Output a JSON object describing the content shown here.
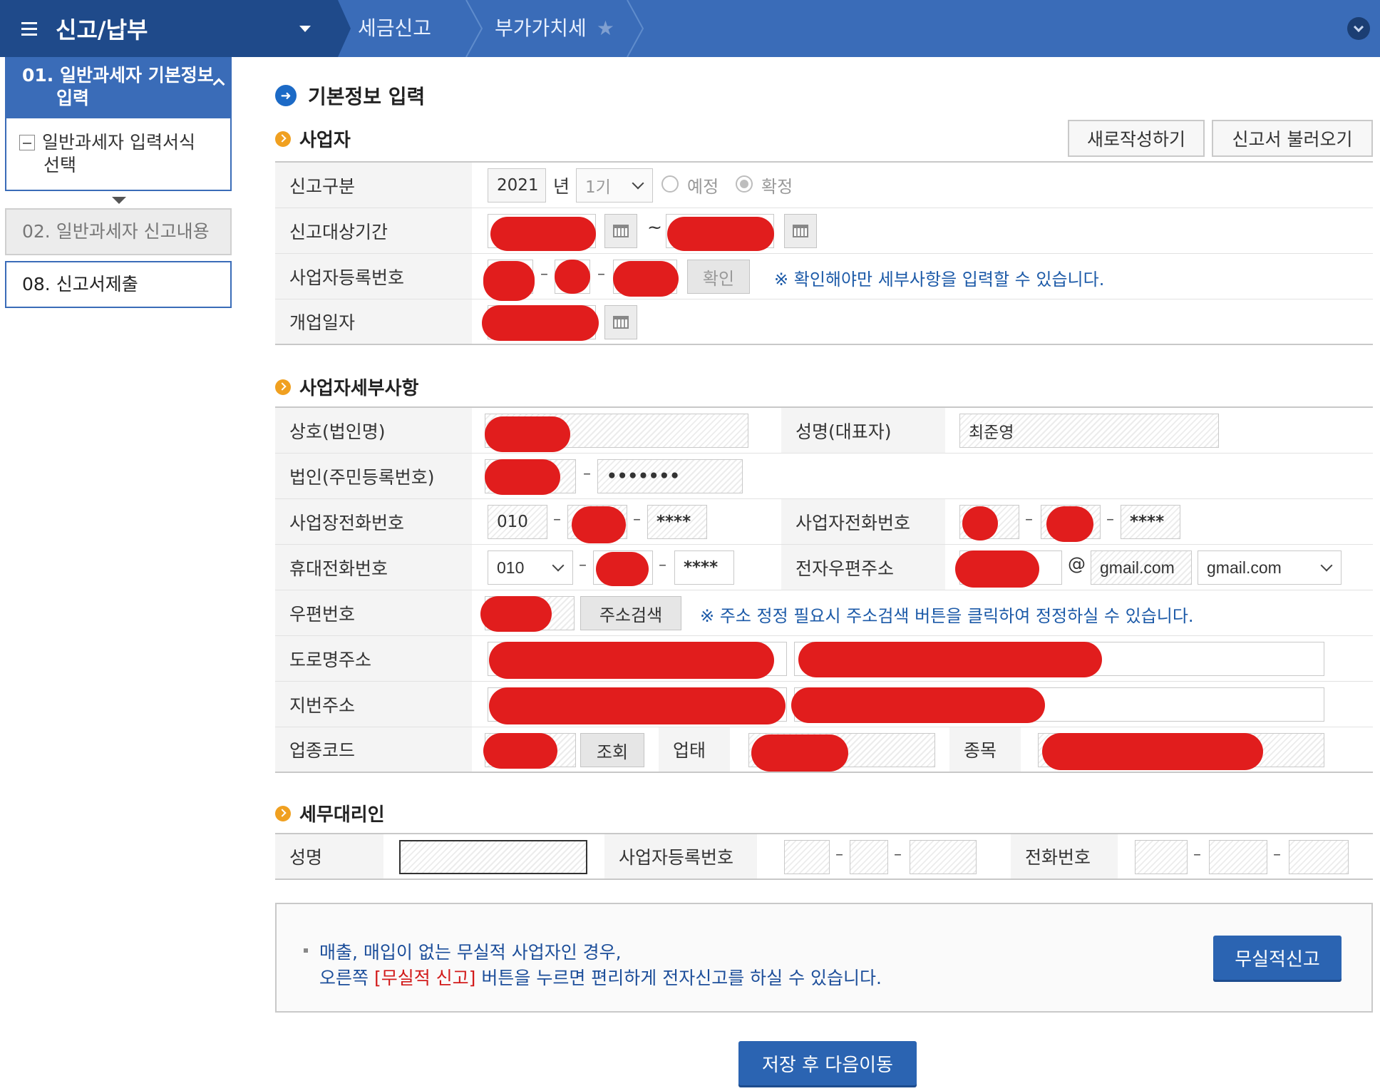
{
  "topbar": {
    "menu_title": "신고/납부",
    "crumbs": [
      "세금신고",
      "부가가치세"
    ]
  },
  "sidebar": {
    "step1_label": "01. 일반과세자 기본정보",
    "step1_label2": "입력",
    "step1_sub": "일반과세자 입력서식",
    "step1_sub2": "선택",
    "step2_label": "02. 일반과세자 신고내용",
    "step8_label": "08. 신고서제출"
  },
  "main": {
    "title": "기본정보 입력",
    "sections": {
      "business": "사업자",
      "detail": "사업자세부사항",
      "agent": "세무대리인"
    },
    "buttons": {
      "new_write": "새로작성하기",
      "load": "신고서 불러오기",
      "confirm": "확인",
      "address_search": "주소검색",
      "lookup": "조회",
      "zero_report": "무실적신고",
      "save_next": "저장 후 다음이동"
    },
    "business": {
      "report_type_label": "신고구분",
      "year": "2021",
      "year_unit": "년",
      "period": "1기",
      "radio_prelim": "예정",
      "radio_final": "확정",
      "target_period_label": "신고대상기간",
      "tilde": "~",
      "reg_no_label": "사업자등록번호",
      "reg_no_note": "※ 확인해야만 세부사항을 입력할 수 있습니다.",
      "open_date_label": "개업일자"
    },
    "detail": {
      "company_label": "상호(법인명)",
      "rep_label": "성명(대표자)",
      "rep_value": "최준영",
      "corp_id_label": "법인(주민등록번호)",
      "corp_id_masked": "•••••••",
      "biz_phone_label": "사업장전화번호",
      "biz_phone_1": "010",
      "biz_phone_3": "****",
      "owner_phone_label": "사업자전화번호",
      "owner_phone_3": "****",
      "mobile_label": "휴대전화번호",
      "mobile_1": "010",
      "mobile_3": "****",
      "email_label": "전자우편주소",
      "email_at": "@",
      "email_domain": "gmail.com",
      "email_select": "gmail.com",
      "zip_label": "우편번호",
      "zip_note": "※ 주소 정정 필요시 주소검색 버튼을 클릭하여 정정하실 수 있습니다.",
      "road_addr_label": "도로명주소",
      "lot_addr_label": "지번주소",
      "industry_label": "업종코드",
      "biz_type_label": "업태",
      "item_label": "종목"
    },
    "agent": {
      "name_label": "성명",
      "reg_no_label": "사업자등록번호",
      "phone_label": "전화번호"
    },
    "info": {
      "line1": "매출, 매입이 없는 무실적 사업자인 경우,",
      "line2_pre": "오른쪽 ",
      "line2_red": "[무실적 신고]",
      "line2_post": " 버튼을 누르면 편리하게 전자신고를 하실 수 있습니다."
    }
  },
  "colors": {
    "header_blue": "#3a6cb8",
    "header_dark": "#1f4a8a",
    "redaction": "#e11d1d",
    "note_blue": "#1c5aa8"
  }
}
